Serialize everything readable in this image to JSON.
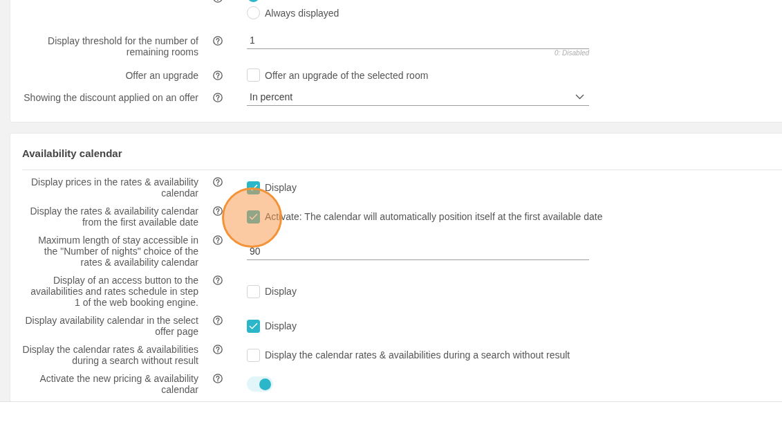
{
  "sections": [
    {
      "rows": [
        {
          "kind": "radio",
          "highlighted": false,
          "options": [
            {
              "selected": true
            },
            {
              "label": "Always displayed",
              "selected": false
            }
          ]
        },
        {
          "kind": "input",
          "label": "Display threshold for the number of\nremaining rooms",
          "value": "1",
          "hint": "0: Disabled",
          "highlighted": false
        },
        {
          "kind": "checkbox",
          "label": "Offer an upgrade",
          "text": "Offer an upgrade of the selected room",
          "checked": false,
          "highlighted": false
        },
        {
          "kind": "select",
          "label": "Showing the discount applied on an offer",
          "value": "In percent",
          "highlighted": false
        }
      ]
    },
    {
      "title": "Availability calendar",
      "rows": [
        {
          "kind": "checkbox",
          "label": "Display prices in the rates & availability\ncalendar",
          "text": "Display",
          "checked": true,
          "highlighted": false
        },
        {
          "kind": "checkbox",
          "label": "Display the rates & availability calendar\nfrom the first available date",
          "text": "Activate: The calendar will automatically position itself at the first available date",
          "checked": true,
          "highlighted": true
        },
        {
          "kind": "input",
          "label": "Maximum length of stay accessible in\nthe \"Number of nights\" choice of the\nrates & availability calendar",
          "value": "90",
          "highlighted": false
        },
        {
          "kind": "checkbox",
          "label": "Display of an access button to the\navailabilities and rates schedule in step\n1 of the web booking engine.",
          "text": "Display",
          "checked": false,
          "highlighted": false
        },
        {
          "kind": "checkbox",
          "label": "Display availability calendar in the select\noffer page",
          "text": "Display",
          "checked": true,
          "highlighted": false
        },
        {
          "kind": "checkbox",
          "label": "Display the calendar rates & availabilities\nduring a search without result",
          "text": "Display the calendar rates & availabilities during a search without result",
          "checked": false,
          "highlighted": false
        },
        {
          "kind": "toggle",
          "label": "Activate the new pricing & availability\ncalendar",
          "on": true,
          "highlighted": false
        }
      ]
    }
  ]
}
